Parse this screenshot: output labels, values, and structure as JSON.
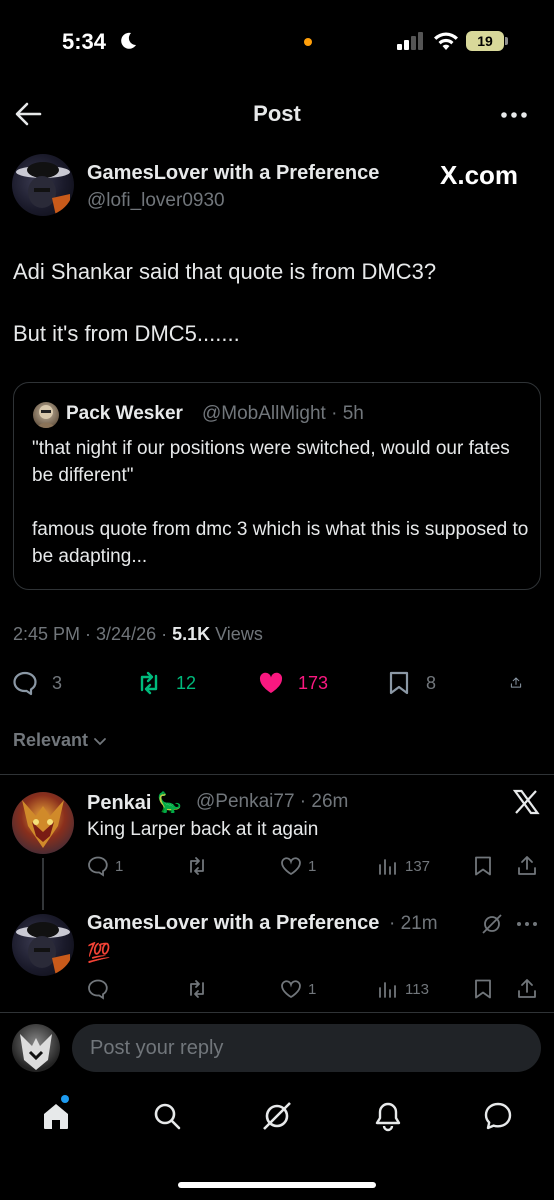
{
  "status_bar": {
    "time": "5:34",
    "battery": "19"
  },
  "header": {
    "title": "Post"
  },
  "post": {
    "author_name": "GamesLover with a Preference",
    "author_handle": "@lofi_lover0930",
    "source_badge": "X.com",
    "text_line1": "Adi Shankar said that quote is from DMC3?",
    "text_line2": "But it's from DMC5.......",
    "timestamp": "2:45 PM · 3/24/26 · ",
    "views_count": "5.1K",
    "views_label": " Views",
    "stats": {
      "replies": "3",
      "reposts": "12",
      "likes": "173",
      "bookmarks": "8"
    }
  },
  "quoted_post": {
    "author_name": "Pack Wesker",
    "author_handle": "@MobAllMight · 5h",
    "text_para1": "\"that night if our positions were switched, would our fates be different\"",
    "text_para2": "famous quote from dmc 3 which is what this is supposed to be adapting..."
  },
  "sort": {
    "label": "Relevant"
  },
  "replies": [
    {
      "author_name": "Penkai 🦕",
      "author_handle": "@Penkai77 · 26m",
      "text": "King Larper back at it again",
      "stats": {
        "replies": "1",
        "reposts": "",
        "likes": "1",
        "views": "137"
      }
    },
    {
      "author_name": "GamesLover with a Preference",
      "author_handle": "· 21m",
      "text": "💯",
      "stats": {
        "replies": "",
        "reposts": "",
        "likes": "1",
        "views": "113"
      }
    }
  ],
  "composer": {
    "placeholder": "Post your reply"
  },
  "colors": {
    "like": "#f91880",
    "repost": "#00ba7c",
    "accent": "#1d9bf0"
  },
  "icons": [
    "back-arrow-icon",
    "more-icon",
    "reply-icon",
    "repost-icon",
    "heart-icon",
    "bookmark-icon",
    "share-icon",
    "views-icon",
    "x-logo-icon",
    "grok-icon",
    "home-icon",
    "search-icon",
    "bell-icon",
    "messages-icon"
  ]
}
